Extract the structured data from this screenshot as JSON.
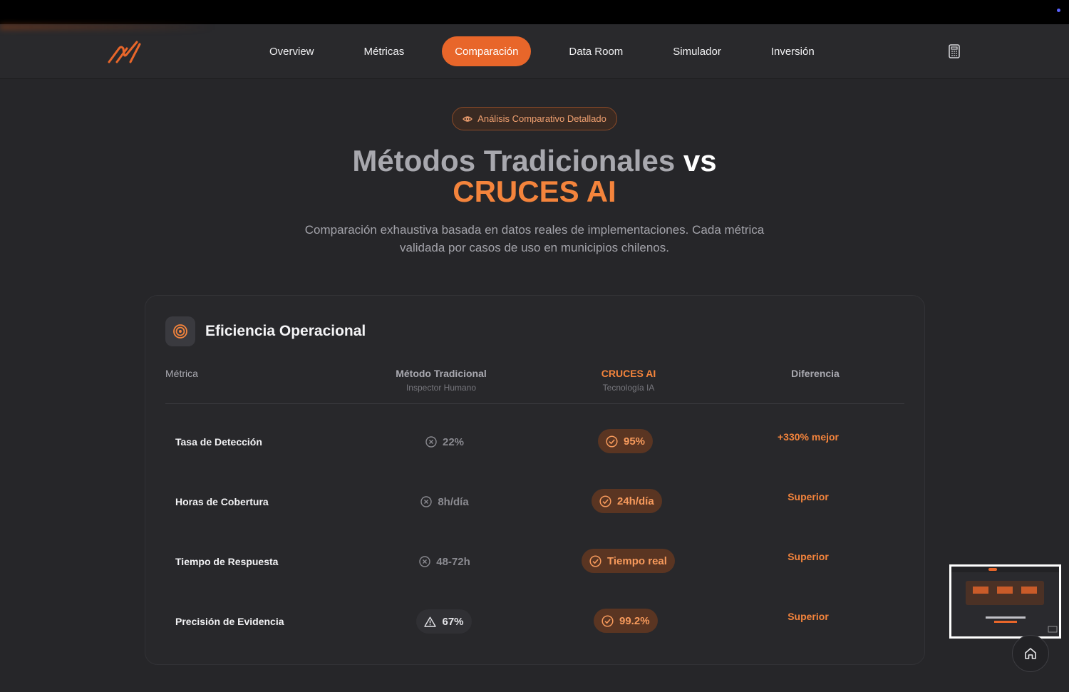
{
  "nav": {
    "links": [
      "Overview",
      "Métricas",
      "Comparación",
      "Data Room",
      "Simulador",
      "Inversión"
    ],
    "active": "Comparación"
  },
  "badge": {
    "label": "Análisis Comparativo Detallado"
  },
  "hero": {
    "title_trad": "Métodos Tradicionales",
    "title_vs": "vs",
    "title_brand": "CRUCES AI",
    "subtitle": "Comparación exhaustiva basada en datos reales de implementaciones. Cada métrica validada por casos de uso en municipios chilenos."
  },
  "card": {
    "title": "Eficiencia Operacional",
    "headers": {
      "metric": "Métrica",
      "traditional": "Método Tradicional",
      "traditional_sub": "Inspector Humano",
      "cruces": "CRUCES AI",
      "cruces_sub": "Tecnología IA",
      "difference": "Diferencia"
    },
    "rows": [
      {
        "metric": "Tasa de Detección",
        "traditional": "22%",
        "traditional_icon": "x-circle-icon",
        "cruces": "95%",
        "difference": "+330% mejor"
      },
      {
        "metric": "Horas de Cobertura",
        "traditional": "8h/día",
        "traditional_icon": "x-circle-icon",
        "cruces": "24h/día",
        "difference": "Superior"
      },
      {
        "metric": "Tiempo de Respuesta",
        "traditional": "48-72h",
        "traditional_icon": "x-circle-icon",
        "cruces": "Tiempo real",
        "difference": "Superior"
      },
      {
        "metric": "Precisión de Evidencia",
        "traditional": "67%",
        "traditional_icon": "warning-triangle-icon",
        "cruces": "99.2%",
        "difference": "Superior"
      }
    ]
  },
  "colors": {
    "accent": "#e8662a",
    "brand_text": "#f4843c",
    "background": "#262629"
  }
}
